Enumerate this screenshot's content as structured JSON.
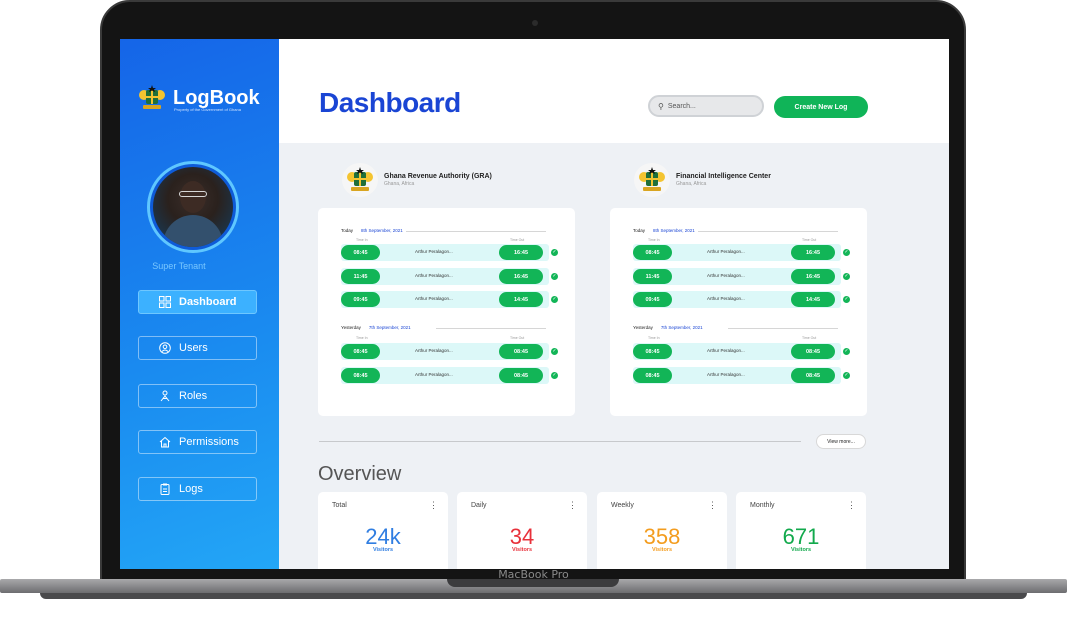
{
  "device": {
    "label": "MacBook Pro"
  },
  "sidebar": {
    "brand": "LogBook",
    "brand_sub": "Property of the Government of Ghana",
    "role": "Super Tenant",
    "items": [
      {
        "label": "Dashboard",
        "icon": "grid-icon",
        "active": true
      },
      {
        "label": "Users",
        "icon": "user-icon",
        "active": false
      },
      {
        "label": "Roles",
        "icon": "roles-icon",
        "active": false
      },
      {
        "label": "Permissions",
        "icon": "home-icon",
        "active": false
      },
      {
        "label": "Logs",
        "icon": "clipboard-icon",
        "active": false
      }
    ]
  },
  "header": {
    "title": "Dashboard",
    "search_placeholder": "Search...",
    "create_button": "Create New Log"
  },
  "agencies": [
    {
      "name": "Ghana Revenue Authority (GRA)",
      "location": "Ghana, Africa",
      "days": [
        {
          "label": "Today",
          "date": "8th September, 2021",
          "time_in_head": "Time In",
          "time_out_head": "Time Out",
          "rows": [
            {
              "time_in": "08:45",
              "name": "Arthur Peralagon...",
              "time_out": "16:45"
            },
            {
              "time_in": "11:45",
              "name": "Arthur Peralagon...",
              "time_out": "16:45"
            },
            {
              "time_in": "09:45",
              "name": "Arthur Peralagon...",
              "time_out": "14:45"
            }
          ]
        },
        {
          "label": "Yesterday",
          "date": "7th September, 2021",
          "time_in_head": "Time In",
          "time_out_head": "Time Out",
          "rows": [
            {
              "time_in": "08:45",
              "name": "Arthur Peralagon...",
              "time_out": "08:45"
            },
            {
              "time_in": "08:45",
              "name": "Arthur Peralagon...",
              "time_out": "08:45"
            }
          ]
        }
      ]
    },
    {
      "name": "Financial Intelligence Center",
      "location": "Ghana, Africa",
      "days": [
        {
          "label": "Today",
          "date": "8th September, 2021",
          "time_in_head": "Time In",
          "time_out_head": "Time Out",
          "rows": [
            {
              "time_in": "08:45",
              "name": "Arthur Peralagon...",
              "time_out": "16:45"
            },
            {
              "time_in": "11:45",
              "name": "Arthur Peralagon...",
              "time_out": "16:45"
            },
            {
              "time_in": "09:45",
              "name": "Arthur Peralagon...",
              "time_out": "14:45"
            }
          ]
        },
        {
          "label": "Yesterday",
          "date": "7th September, 2021",
          "time_in_head": "Time In",
          "time_out_head": "Time Out",
          "rows": [
            {
              "time_in": "08:45",
              "name": "Arthur Peralagon...",
              "time_out": "08:45"
            },
            {
              "time_in": "08:45",
              "name": "Arthur Peralagon...",
              "time_out": "08:45"
            }
          ]
        }
      ]
    }
  ],
  "view_more": "View more...",
  "overview": {
    "title": "Overview",
    "cards": [
      {
        "label": "Total",
        "value": "24k",
        "unit": "Visitors",
        "color": "#2f7de1"
      },
      {
        "label": "Daily",
        "value": "34",
        "unit": "Visitors",
        "color": "#e8303a"
      },
      {
        "label": "Weekly",
        "value": "358",
        "unit": "Visitors",
        "color": "#f39c1e"
      },
      {
        "label": "Monthly",
        "value": "671",
        "unit": "Visitors",
        "color": "#12a94c"
      }
    ]
  }
}
